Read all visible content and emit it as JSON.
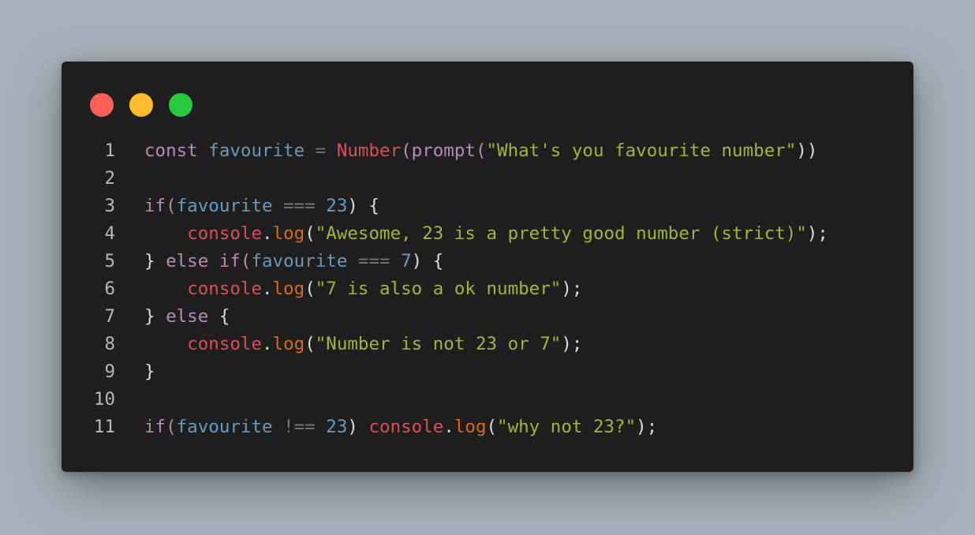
{
  "window": {
    "controls": [
      {
        "name": "close",
        "color": "#ff5f56"
      },
      {
        "name": "minimize",
        "color": "#ffbd2e"
      },
      {
        "name": "maximize",
        "color": "#27c93f"
      }
    ]
  },
  "code": {
    "lines": [
      {
        "number": "1",
        "tokens": [
          {
            "t": "const",
            "c": "kw"
          },
          {
            "t": " ",
            "c": "pn"
          },
          {
            "t": "favourite",
            "c": "var"
          },
          {
            "t": " ",
            "c": "pn"
          },
          {
            "t": "=",
            "c": "op"
          },
          {
            "t": " ",
            "c": "pn"
          },
          {
            "t": "Number",
            "c": "cls"
          },
          {
            "t": "(",
            "c": "pnf"
          },
          {
            "t": "prompt",
            "c": "kw"
          },
          {
            "t": "(",
            "c": "pnf"
          },
          {
            "t": "\"What's you favourite number\"",
            "c": "str"
          },
          {
            "t": "))",
            "c": "pn"
          }
        ]
      },
      {
        "number": "2",
        "tokens": []
      },
      {
        "number": "3",
        "tokens": [
          {
            "t": "if",
            "c": "kw"
          },
          {
            "t": "(",
            "c": "pnf"
          },
          {
            "t": "favourite",
            "c": "var"
          },
          {
            "t": " ",
            "c": "pn"
          },
          {
            "t": "===",
            "c": "op"
          },
          {
            "t": " ",
            "c": "pn"
          },
          {
            "t": "23",
            "c": "num"
          },
          {
            "t": ") {",
            "c": "pn"
          }
        ]
      },
      {
        "number": "4",
        "tokens": [
          {
            "t": "    ",
            "c": "pn"
          },
          {
            "t": "console",
            "c": "cls"
          },
          {
            "t": ".",
            "c": "pn"
          },
          {
            "t": "log",
            "c": "fn"
          },
          {
            "t": "(",
            "c": "pn"
          },
          {
            "t": "\"Awesome, 23 is a pretty good number (strict)\"",
            "c": "str"
          },
          {
            "t": ");",
            "c": "pn"
          }
        ]
      },
      {
        "number": "5",
        "tokens": [
          {
            "t": "} ",
            "c": "pn"
          },
          {
            "t": "else",
            "c": "kw"
          },
          {
            "t": " ",
            "c": "pn"
          },
          {
            "t": "if",
            "c": "kw"
          },
          {
            "t": "(",
            "c": "pnf"
          },
          {
            "t": "favourite",
            "c": "var"
          },
          {
            "t": " ",
            "c": "pn"
          },
          {
            "t": "===",
            "c": "op"
          },
          {
            "t": " ",
            "c": "pn"
          },
          {
            "t": "7",
            "c": "num"
          },
          {
            "t": ") {",
            "c": "pn"
          }
        ]
      },
      {
        "number": "6",
        "tokens": [
          {
            "t": "    ",
            "c": "pn"
          },
          {
            "t": "console",
            "c": "cls"
          },
          {
            "t": ".",
            "c": "pn"
          },
          {
            "t": "log",
            "c": "fn"
          },
          {
            "t": "(",
            "c": "pn"
          },
          {
            "t": "\"7 is also a ok number\"",
            "c": "str"
          },
          {
            "t": ");",
            "c": "pn"
          }
        ]
      },
      {
        "number": "7",
        "tokens": [
          {
            "t": "} ",
            "c": "pn"
          },
          {
            "t": "else",
            "c": "kw"
          },
          {
            "t": " {",
            "c": "pn"
          }
        ]
      },
      {
        "number": "8",
        "tokens": [
          {
            "t": "    ",
            "c": "pn"
          },
          {
            "t": "console",
            "c": "cls"
          },
          {
            "t": ".",
            "c": "pn"
          },
          {
            "t": "log",
            "c": "fn"
          },
          {
            "t": "(",
            "c": "pn"
          },
          {
            "t": "\"Number is not 23 or 7\"",
            "c": "str"
          },
          {
            "t": ");",
            "c": "pn"
          }
        ]
      },
      {
        "number": "9",
        "tokens": [
          {
            "t": "}",
            "c": "pn"
          }
        ]
      },
      {
        "number": "10",
        "tokens": []
      },
      {
        "number": "11",
        "tokens": [
          {
            "t": "if",
            "c": "kw"
          },
          {
            "t": "(",
            "c": "pnf"
          },
          {
            "t": "favourite",
            "c": "var"
          },
          {
            "t": " ",
            "c": "pn"
          },
          {
            "t": "!==",
            "c": "op"
          },
          {
            "t": " ",
            "c": "pn"
          },
          {
            "t": "23",
            "c": "num"
          },
          {
            "t": ") ",
            "c": "pn"
          },
          {
            "t": "console",
            "c": "cls"
          },
          {
            "t": ".",
            "c": "pn"
          },
          {
            "t": "log",
            "c": "fn"
          },
          {
            "t": "(",
            "c": "pn"
          },
          {
            "t": "\"why not 23?\"",
            "c": "str"
          },
          {
            "t": ");",
            "c": "pn"
          }
        ]
      }
    ]
  }
}
